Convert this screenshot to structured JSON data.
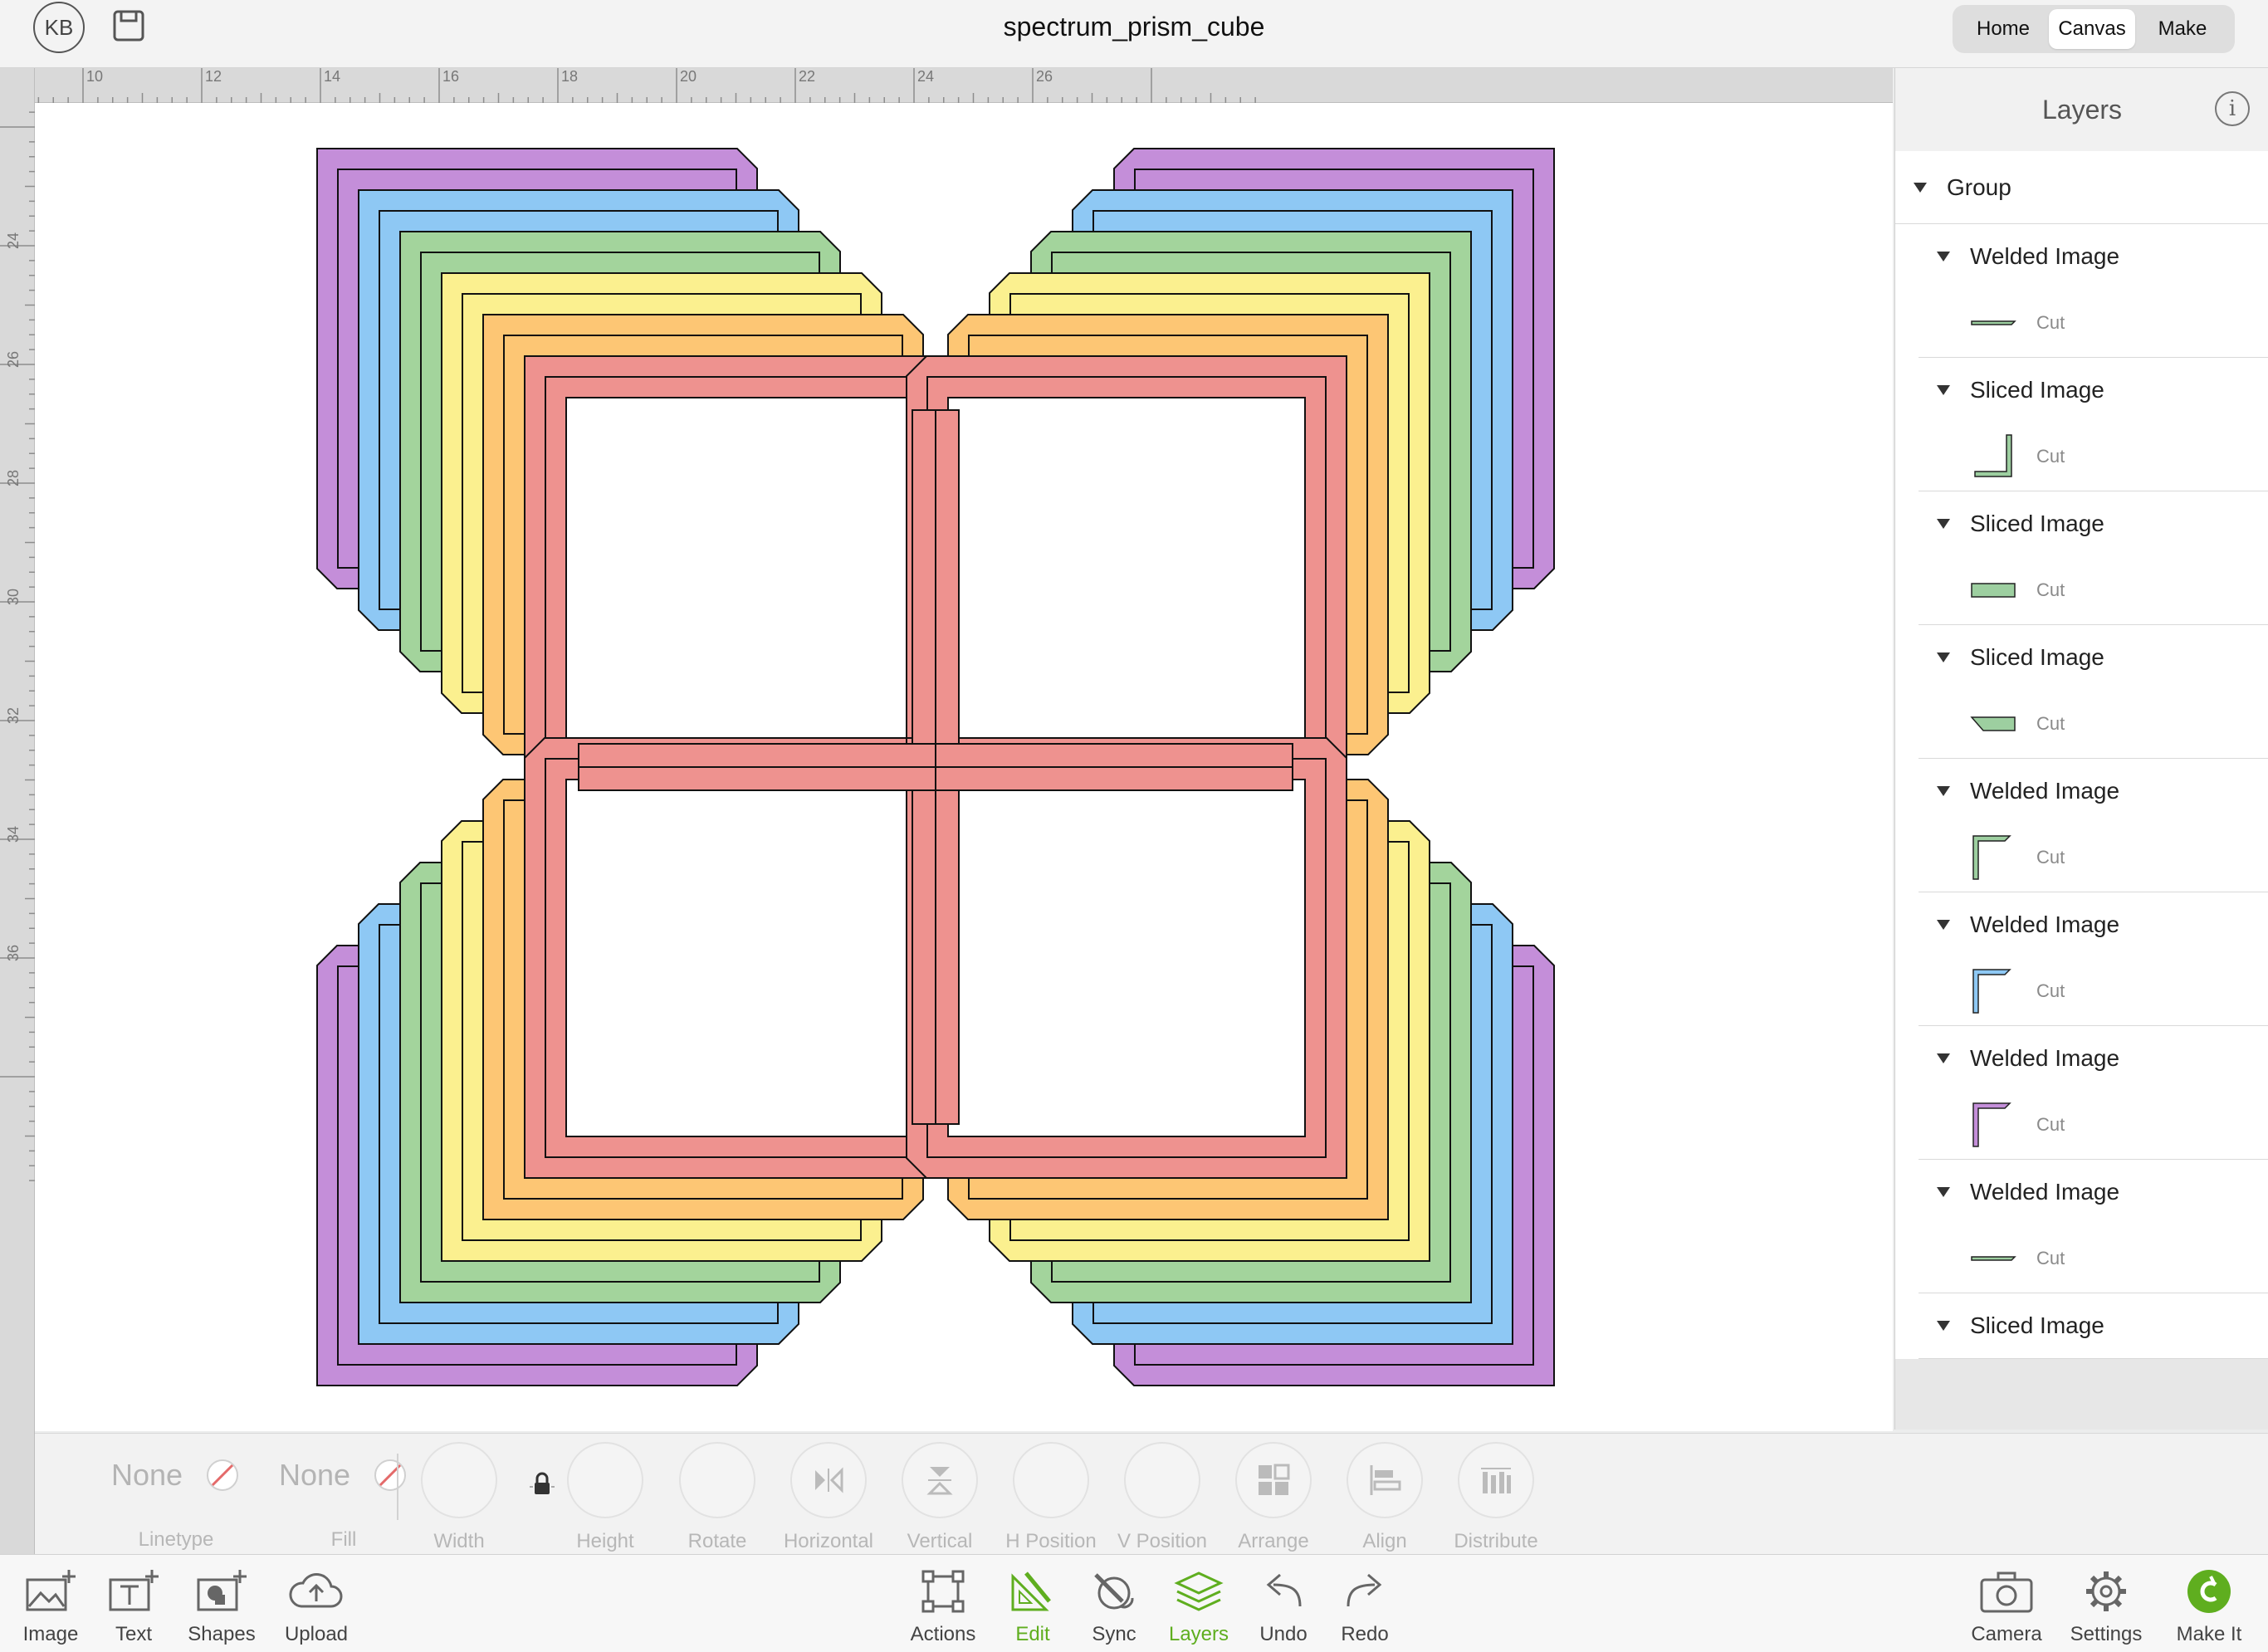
{
  "topbar": {
    "avatar_initials": "KB",
    "document_title": "spectrum_prism_cube",
    "nav": {
      "home": "Home",
      "canvas": "Canvas",
      "make": "Make"
    },
    "active_nav": "Canvas"
  },
  "ruler": {
    "top_labels": [
      "10",
      "12",
      "14",
      "16",
      "18",
      "20",
      "22",
      "24",
      "26"
    ],
    "left_labels": [
      "24",
      "26",
      "28",
      "30",
      "32",
      "34",
      "36"
    ]
  },
  "canvas": {
    "rainbow_colors": [
      "#c48ed9",
      "#8ec8f4",
      "#a3d49c",
      "#fbf08f",
      "#fdc674",
      "#ee928f"
    ],
    "stroke_color": "#111111",
    "background": "#ffffff"
  },
  "layers_panel": {
    "title": "Layers",
    "info_icon": "info-icon",
    "group_label": "Group",
    "items": [
      {
        "name": "Welded Image",
        "operation": "Cut",
        "thumb_icon": "horizontal-bar-shape-icon",
        "thumb_color": "#9dcfa0"
      },
      {
        "name": "Sliced Image",
        "operation": "Cut",
        "thumb_icon": "corner-bracket-shape-icon",
        "thumb_color": "#9dcfa0"
      },
      {
        "name": "Sliced Image",
        "operation": "Cut",
        "thumb_icon": "rectangle-shape-icon",
        "thumb_color": "#9dcfa0"
      },
      {
        "name": "Sliced Image",
        "operation": "Cut",
        "thumb_icon": "trapezoid-shape-icon",
        "thumb_color": "#9dcfa0"
      },
      {
        "name": "Welded Image",
        "operation": "Cut",
        "thumb_icon": "l-shape-icon",
        "thumb_color": "#9dcfa0"
      },
      {
        "name": "Welded Image",
        "operation": "Cut",
        "thumb_icon": "l-shape-icon",
        "thumb_color": "#8ec8f4"
      },
      {
        "name": "Welded Image",
        "operation": "Cut",
        "thumb_icon": "l-shape-icon",
        "thumb_color": "#c48ed9"
      },
      {
        "name": "Welded Image",
        "operation": "Cut",
        "thumb_icon": "horizontal-bar-shape-icon",
        "thumb_color": "#9dcfa0"
      },
      {
        "name": "Sliced Image",
        "operation": null,
        "thumb_icon": null,
        "thumb_color": null
      }
    ]
  },
  "edit_toolbar": {
    "linetype_value": "None",
    "linetype_label": "Linetype",
    "fill_value": "None",
    "fill_label": "Fill",
    "width_label": "Width",
    "height_label": "Height",
    "rotate_label": "Rotate",
    "horizontal_label": "Horizontal",
    "vertical_label": "Vertical",
    "hposition_label": "H Position",
    "vposition_label": "V Position",
    "arrange_label": "Arrange",
    "align_label": "Align",
    "distribute_label": "Distribute"
  },
  "bottom_toolbar": {
    "image": "Image",
    "text": "Text",
    "shapes": "Shapes",
    "upload": "Upload",
    "actions": "Actions",
    "edit": "Edit",
    "sync": "Sync",
    "layers": "Layers",
    "undo": "Undo",
    "redo": "Redo",
    "camera": "Camera",
    "settings": "Settings",
    "make_it": "Make It",
    "accent_color": "#5fae1f"
  }
}
